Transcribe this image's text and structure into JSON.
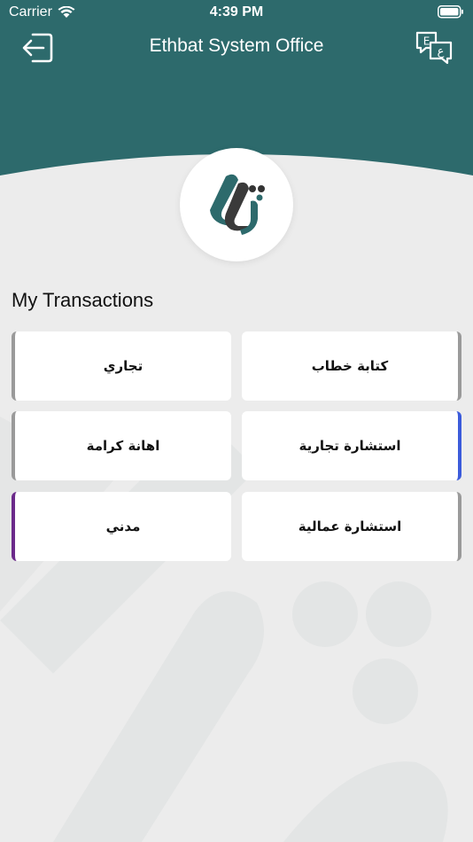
{
  "status_bar": {
    "carrier": "Carrier",
    "time": "4:39 PM"
  },
  "nav": {
    "title": "Ethbat System Office",
    "logout_icon": "logout-icon",
    "language_icon": "language-toggle-icon"
  },
  "colors": {
    "header": "#2d6a6c",
    "background": "#ececec",
    "card": "#ffffff",
    "accent_gray": "#9a9a9a",
    "accent_blue": "#3b5bdb",
    "accent_purple": "#6b2a8a"
  },
  "section": {
    "title": "My Transactions"
  },
  "transactions": [
    {
      "label": "كتابة خطاب",
      "accent": "#9a9a9a"
    },
    {
      "label": "تجاري",
      "accent": "#9a9a9a"
    },
    {
      "label": "استشارة تجارية",
      "accent": "#3b5bdb"
    },
    {
      "label": "اهانة كرامة",
      "accent": "#9a9a9a"
    },
    {
      "label": "استشارة عمالية",
      "accent": "#9a9a9a"
    },
    {
      "label": "مدني",
      "accent": "#6b2a8a"
    }
  ]
}
